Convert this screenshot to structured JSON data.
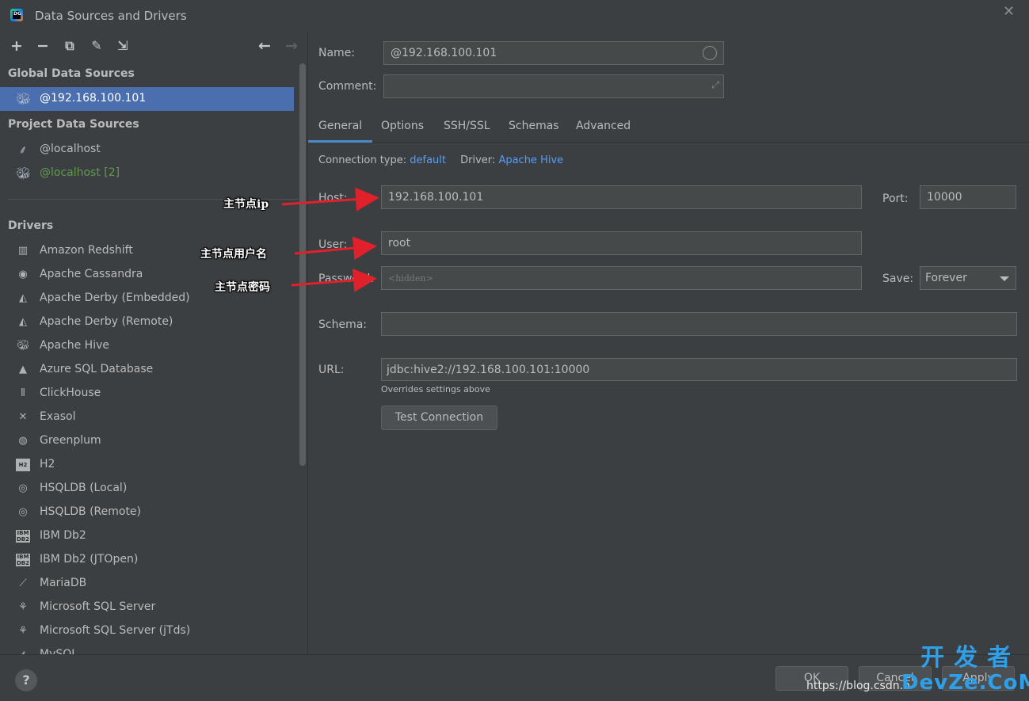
{
  "window": {
    "title": "Data Sources and Drivers",
    "app_icon_text": "DG"
  },
  "toolbar": {
    "add": "+",
    "remove": "−",
    "copy": "⧉",
    "settings": "✎",
    "import": "⇲",
    "back": "←",
    "forward": "→"
  },
  "sidebar": {
    "global_header": "Global Data Sources",
    "global_items": [
      {
        "label": "@192.168.100.101",
        "icon": "hive-icon"
      }
    ],
    "project_header": "Project Data Sources",
    "project_items": [
      {
        "label": "@localhost",
        "icon": "mysql-icon"
      },
      {
        "label": "@localhost [2]",
        "icon": "hive-icon"
      }
    ],
    "drivers_header": "Drivers",
    "drivers": [
      "Amazon Redshift",
      "Apache Cassandra",
      "Apache Derby (Embedded)",
      "Apache Derby (Remote)",
      "Apache Hive",
      "Azure SQL Database",
      "ClickHouse",
      "Exasol",
      "Greenplum",
      "H2",
      "HSQLDB (Local)",
      "HSQLDB (Remote)",
      "IBM Db2",
      "IBM Db2 (JTOpen)",
      "MariaDB",
      "Microsoft SQL Server",
      "Microsoft SQL Server (jTds)",
      "MySQL"
    ]
  },
  "form": {
    "name_label": "Name:",
    "name_value": "@192.168.100.101",
    "comment_label": "Comment:",
    "comment_value": "",
    "tabs": [
      "General",
      "Options",
      "SSH/SSL",
      "Schemas",
      "Advanced"
    ],
    "connection_type_label": "Connection type:",
    "connection_type_value": "default",
    "driver_label": "Driver:",
    "driver_value": "Apache Hive",
    "host_label": "Host:",
    "host_value": "192.168.100.101",
    "port_label": "Port:",
    "port_value": "10000",
    "user_label": "User:",
    "user_value": "root",
    "password_label": "Password:",
    "password_placeholder": "<hidden>",
    "save_label": "Save:",
    "save_value": "Forever",
    "schema_label": "Schema:",
    "schema_value": "",
    "url_label": "URL:",
    "url_value": "jdbc:hive2://192.168.100.101:10000",
    "url_hint": "Overrides settings above",
    "test_connection": "Test Connection"
  },
  "footer": {
    "help": "?",
    "ok": "OK",
    "cancel": "Cancel",
    "apply": "Apply"
  },
  "annotations": {
    "host": "主节点ip",
    "user": "主节点用户名",
    "password": "主节点密码"
  },
  "watermark": {
    "top": "开发者",
    "bottom": "DevZe.CoM",
    "csdn": "https://blog.csdn.n"
  },
  "colors": {
    "accent_blue": "#4b6eaf",
    "link": "#589df6",
    "arrow": "#e0202a",
    "watermark": "#2f9fe8"
  }
}
